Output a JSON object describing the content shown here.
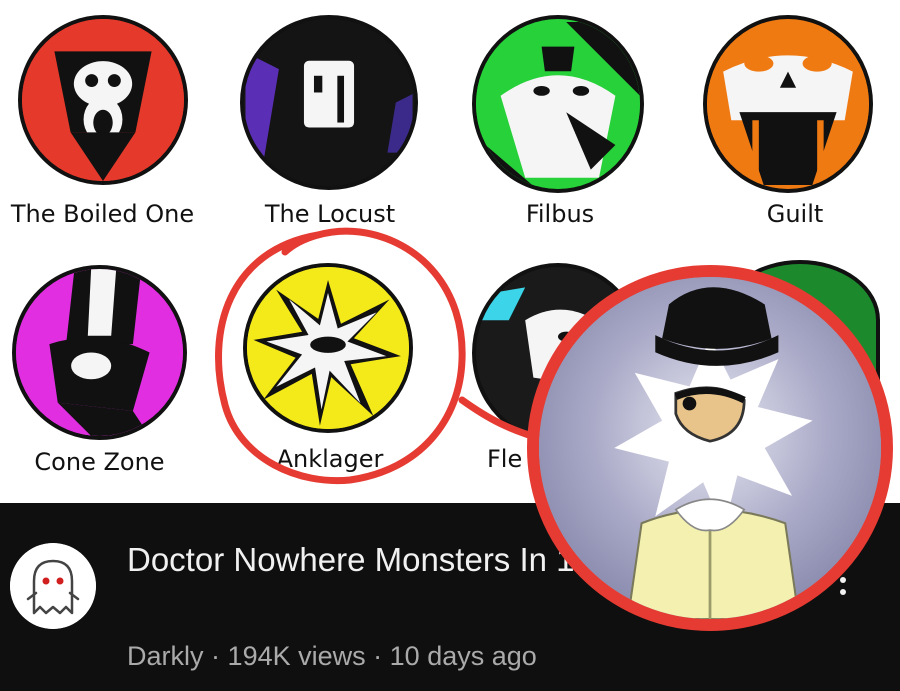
{
  "thumbnail": {
    "monsters": [
      {
        "name": "The Boiled One",
        "color": "#e53a2b"
      },
      {
        "name": "The Locust",
        "color": "#4b2a8f"
      },
      {
        "name": "Filbus",
        "color": "#27d13a"
      },
      {
        "name": "Guilt",
        "color": "#f07a12"
      },
      {
        "name": "Cone Zone",
        "color": "#e12ee0"
      },
      {
        "name": "Anklager",
        "color": "#f4ea1a"
      },
      {
        "name": "Fle",
        "color": "#1a1a1a"
      }
    ],
    "highlight_color": "#e63b32"
  },
  "video": {
    "title": "Doctor Nowhere Monsters In 10 Minutes",
    "channel": "Darkly",
    "separator": "·",
    "views": "194K views",
    "uploaded": "10 days ago",
    "avatar_icon": "ghost-icon",
    "menu_icon": "more-vert-icon"
  }
}
